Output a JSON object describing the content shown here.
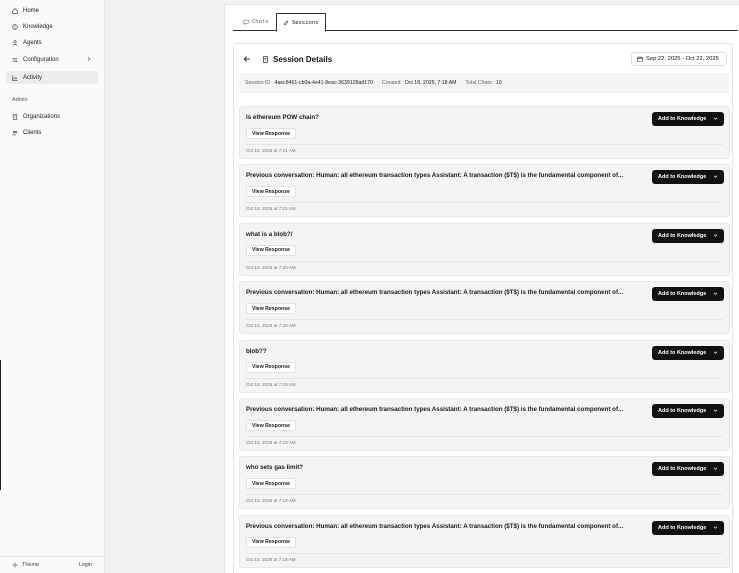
{
  "sidebar": {
    "items": [
      {
        "label": "Home",
        "icon": "home-icon"
      },
      {
        "label": "Knowledge",
        "icon": "brain-icon"
      },
      {
        "label": "Agents",
        "icon": "user-icon"
      },
      {
        "label": "Configuration",
        "icon": "sliders-icon"
      },
      {
        "label": "Activity",
        "icon": "chart-icon"
      }
    ],
    "section_label": "Admin",
    "admin_items": [
      {
        "label": "Organizations",
        "icon": "building-icon"
      },
      {
        "label": "Clients",
        "icon": "users-icon"
      }
    ],
    "footer": {
      "theme_label": "Theme",
      "login_label": "Login"
    }
  },
  "tabs": [
    {
      "label": "Chats",
      "icon": "chat-icon"
    },
    {
      "label": "Sessions",
      "icon": "link-icon"
    }
  ],
  "session": {
    "title": "Session Details",
    "date_range": "Sep 22, 2025 - Oct 22, 2025",
    "meta": {
      "id_label": "Session ID:",
      "id_value": "4aec8461-cb0a-4e41-8eac-3639128ad170",
      "created_label": "Created:",
      "created_value": "Oct 18, 2025, 7:18 AM",
      "total_label": "Total Chats:",
      "total_value": "10"
    },
    "view_label": "View Response",
    "add_label": "Add to Knowledge",
    "chats": [
      {
        "question": "Is ethereum POW chain?",
        "time": "Oct 18, 2025 at 7:21 AM"
      },
      {
        "question": "Previous conversation: Human: all ethereum transaction types Assistant: A transaction ($T$) is the fundamental component of...",
        "time": "Oct 18, 2025 at 7:21 AM"
      },
      {
        "question": "what is a blob?/",
        "time": "Oct 18, 2025 at 7:20 AM"
      },
      {
        "question": "Previous conversation: Human: all ethereum transaction types Assistant: A transaction ($T$) is the fundamental component of...",
        "time": "Oct 18, 2025 at 7:20 AM"
      },
      {
        "question": "blob??",
        "time": "Oct 18, 2025 at 7:19 AM"
      },
      {
        "question": "Previous conversation: Human: all ethereum transaction types Assistant: A transaction ($T$) is the fundamental component of...",
        "time": "Oct 18, 2025 at 7:19 AM"
      },
      {
        "question": "who sets gas limit?",
        "time": "Oct 18, 2025 at 7:19 AM"
      },
      {
        "question": "Previous conversation: Human: all ethereum transaction types Assistant: A transaction ($T$) is the fundamental component of...",
        "time": "Oct 18, 2025 at 7:18 AM"
      }
    ]
  }
}
